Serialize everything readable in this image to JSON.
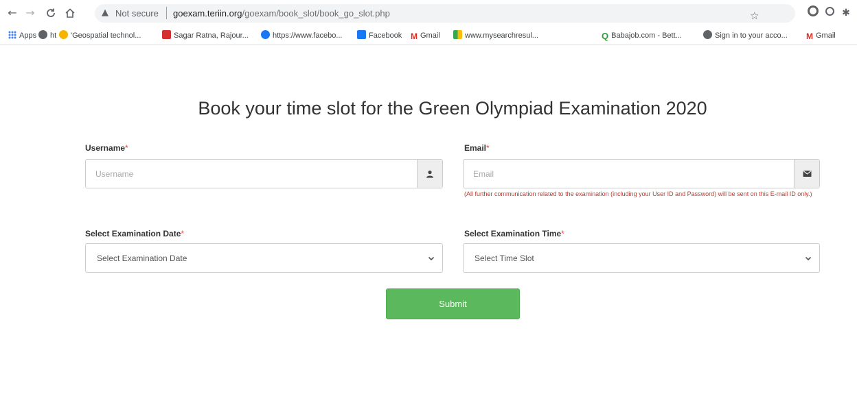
{
  "browser": {
    "security_label": "Not secure",
    "url_host": "goexam.teriin.org",
    "url_path": "/goexam/book_slot/book_go_slot.php",
    "bookmarks": [
      "Apps",
      "ht",
      "'Geospatial technol...",
      "Sagar Ratna, Rajour...",
      "https://www.facebo...",
      "Facebook",
      "Gmail",
      "www.mysearchresul...",
      "Babajob.com - Bett...",
      "Sign in to your acco...",
      "Gmail"
    ]
  },
  "page": {
    "title": "Book your time slot for the Green Olympiad Examination 2020",
    "required_mark": "*",
    "username": {
      "label": "Username",
      "placeholder": "Username"
    },
    "email": {
      "label": "Email",
      "placeholder": "Email",
      "help": "(All further communication related to the examination (including your User ID and Password) will be sent on this E-mail ID only.)"
    },
    "exam_date": {
      "label": "Select Examination Date",
      "selected": "Select Examination Date"
    },
    "exam_time": {
      "label": "Select Examination Time",
      "selected": "Select Time Slot"
    },
    "submit_label": "Submit"
  },
  "colors": {
    "submit_bg": "#5cb85c",
    "required": "#e74c3c",
    "help_text": "#c0392b"
  }
}
